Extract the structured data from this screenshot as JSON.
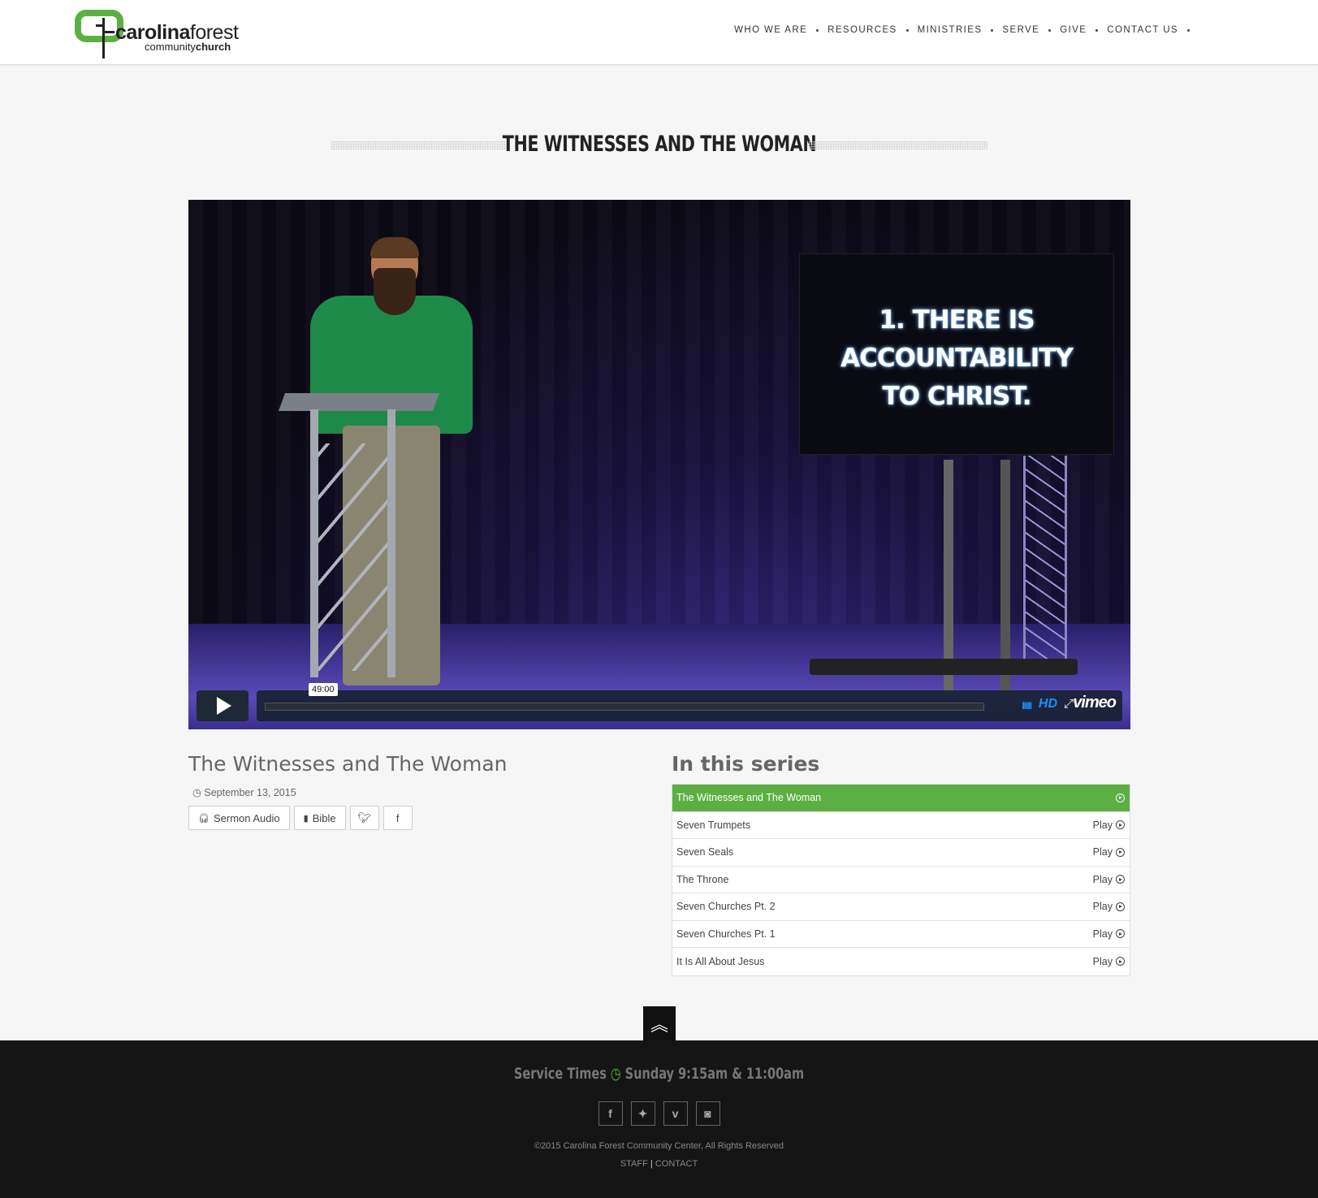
{
  "header": {
    "logo_primary_bold": "carolina",
    "logo_primary_rest": "forest",
    "logo_secondary_rest": "community",
    "logo_secondary_bold": "church",
    "nav": [
      "WHO WE ARE",
      "RESOURCES",
      "MINISTRIES",
      "SERVE",
      "GIVE",
      "CONTACT US"
    ]
  },
  "page": {
    "title": "THE WITNESSES AND THE WOMAN"
  },
  "video": {
    "slide_line1": "1. THERE IS",
    "slide_line2": "ACCOUNTABILITY",
    "slide_line3": "TO CHRIST.",
    "duration": "49:00",
    "hd_label": "HD",
    "provider": "vimeo",
    "volume_glyph": "IIIII"
  },
  "sermon": {
    "title": "The Witnesses and The Woman",
    "date": "September 13, 2015",
    "audio_label": "Sermon Audio",
    "bible_label": "Bible"
  },
  "series": {
    "heading": "In this series",
    "play_label": "Play",
    "items": [
      {
        "title": "The Witnesses and The Woman",
        "active": true
      },
      {
        "title": "Seven Trumpets",
        "active": false
      },
      {
        "title": "Seven Seals",
        "active": false
      },
      {
        "title": "The Throne",
        "active": false
      },
      {
        "title": "Seven Churches Pt. 2",
        "active": false
      },
      {
        "title": "Seven Churches Pt. 1",
        "active": false
      },
      {
        "title": "It Is All About Jesus",
        "active": false
      }
    ]
  },
  "footer": {
    "service_label": "Service Times",
    "service_times": "Sunday 9:15am & 11:00am",
    "copyright": "©2015 Carolina Forest Community Center, All Rights Reserved",
    "link_staff": "STAFF",
    "link_contact": "CONTACT",
    "link_separator": "|"
  },
  "colors": {
    "accent": "#5cb043",
    "footer_bg": "#151515",
    "player_blue": "#1e90ff"
  }
}
